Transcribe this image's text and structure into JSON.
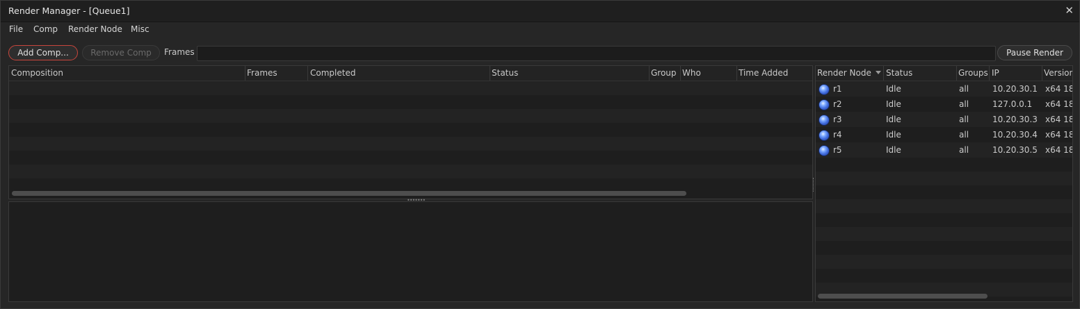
{
  "window": {
    "title": "Render Manager - [Queue1]"
  },
  "menu": {
    "items": [
      "File",
      "Comp",
      "Render Node",
      "Misc"
    ]
  },
  "toolbar": {
    "add_comp": "Add Comp...",
    "remove_comp": "Remove Comp",
    "frames_label": "Frames",
    "frames_value": "",
    "pause_render": "Pause Render"
  },
  "comp_table": {
    "columns": [
      "Composition",
      "Frames",
      "Completed",
      "Status",
      "Group",
      "Who",
      "Time Added"
    ],
    "rows": []
  },
  "node_table": {
    "columns": [
      "Render Node",
      "Status",
      "Groups",
      "IP",
      "Version"
    ],
    "sort_column": "Render Node",
    "rows": [
      {
        "name": "r1",
        "status": "Idle",
        "groups": "all",
        "ip": "10.20.30.1",
        "version": "x64 18"
      },
      {
        "name": "r2",
        "status": "Idle",
        "groups": "all",
        "ip": "127.0.0.1",
        "version": "x64 18"
      },
      {
        "name": "r3",
        "status": "Idle",
        "groups": "all",
        "ip": "10.20.30.3",
        "version": "x64 18"
      },
      {
        "name": "r4",
        "status": "Idle",
        "groups": "all",
        "ip": "10.20.30.4",
        "version": "x64 18"
      },
      {
        "name": "r5",
        "status": "Idle",
        "groups": "all",
        "ip": "10.20.30.5",
        "version": "x64 18"
      }
    ]
  },
  "icons": {
    "close": "close-icon",
    "node": "render-node-status-icon",
    "sort": "sort-descending-icon"
  },
  "colors": {
    "accent": "#c8463c",
    "node_icon": "#3c66d8"
  }
}
